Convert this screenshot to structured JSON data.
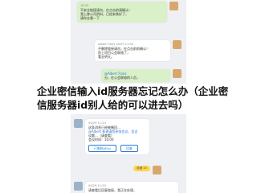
{
  "overlay": {
    "line1": "企业密信输入id服务器忘记怎么办（企业密",
    "line2": "信服务器id别人给的可以进去吗）"
  },
  "chat": {
    "msg1": {
      "meta": "18:35",
      "lines": [
        "不安全链接请勿，在点击前请确认！",
        "我上移公司资料，已经安装好了，",
        "请你去看一下"
      ],
      "tag": "已读"
    },
    "msg2": {
      "meta": "Albert Fions 04/29 11:00",
      "lines": [
        "不删除链接请勿，在点击前前确认！",
        "别上项目公会联络了，",
        "看业明天。"
      ]
    },
    "msg3": {
      "mention": "@Albert Fions",
      "lines": [
        "分，在公会联络的人员，",
        "收好",
        "修改。"
      ]
    },
    "msg4": {
      "meta": "04/29 11:24",
      "lines": [
        "这条消息已经被撤回…",
        "@Albert 新邀请您参加会议，会议",
        "议题…（请查看）",
        "会议时间：10:00"
      ],
      "buttons": [
        "已复制(65s)",
        "回复"
      ]
    },
    "msg5": {
      "meta": "04/29 11:26",
      "fav": "收藏",
      "lines": [
        "蓝色系列资料…（全部）"
      ]
    },
    "msg6": {
      "meta": "04/29 11:30",
      "lines": [
        "请查看后回复链接，我正在处理，",
        "在点击前请确认！"
      ]
    },
    "fav_count": "25"
  }
}
